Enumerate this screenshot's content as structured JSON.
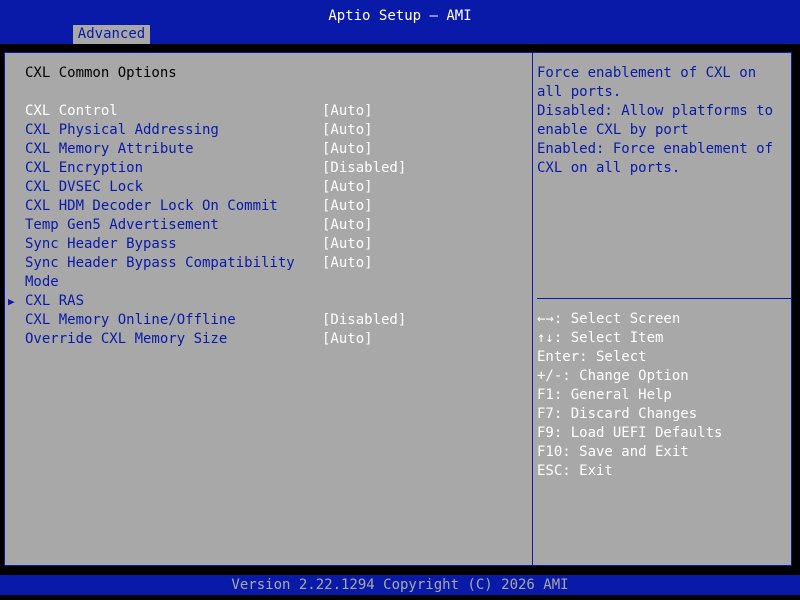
{
  "header": {
    "title": "Aptio Setup – AMI",
    "tab": "Advanced"
  },
  "page": {
    "heading": "CXL Common Options"
  },
  "options": [
    {
      "label": "CXL Control",
      "value": "[Auto]",
      "selected": true
    },
    {
      "label": "CXL Physical Addressing",
      "value": "[Auto]"
    },
    {
      "label": "CXL Memory Attribute",
      "value": "[Auto]"
    },
    {
      "label": "CXL Encryption",
      "value": "[Disabled]"
    },
    {
      "label": "CXL DVSEC Lock",
      "value": "[Auto]"
    },
    {
      "label": "CXL HDM Decoder Lock On Commit",
      "value": "[Auto]"
    },
    {
      "label": "Temp Gen5 Advertisement",
      "value": "[Auto]"
    },
    {
      "label": "Sync Header Bypass",
      "value": "[Auto]"
    },
    {
      "label": "Sync Header Bypass Compatibility Mode",
      "value": "[Auto]",
      "multiline": true
    },
    {
      "label": "CXL RAS",
      "value": "",
      "submenu": true
    },
    {
      "label": "CXL Memory Online/Offline",
      "value": "[Disabled]"
    },
    {
      "label": "Override CXL Memory Size",
      "value": "[Auto]"
    }
  ],
  "help": {
    "text": "Force enablement of CXL on all ports.\nDisabled: Allow platforms to enable CXL by port\nEnabled: Force enablement of CXL on all ports."
  },
  "keys": [
    "←→: Select Screen",
    "↑↓: Select Item",
    "Enter: Select",
    "+/-: Change Option",
    "F1: General Help",
    "F7: Discard Changes",
    "F9: Load UEFI Defaults",
    "F10: Save and Exit",
    "ESC: Exit"
  ],
  "footer": {
    "text": "Version 2.22.1294 Copyright (C) 2026 AMI"
  },
  "colors": {
    "blue": "#0a1aa8",
    "gray": "#a8a8a8",
    "white": "#ffffff"
  },
  "icons": {
    "submenu": "triangle-right-icon"
  }
}
